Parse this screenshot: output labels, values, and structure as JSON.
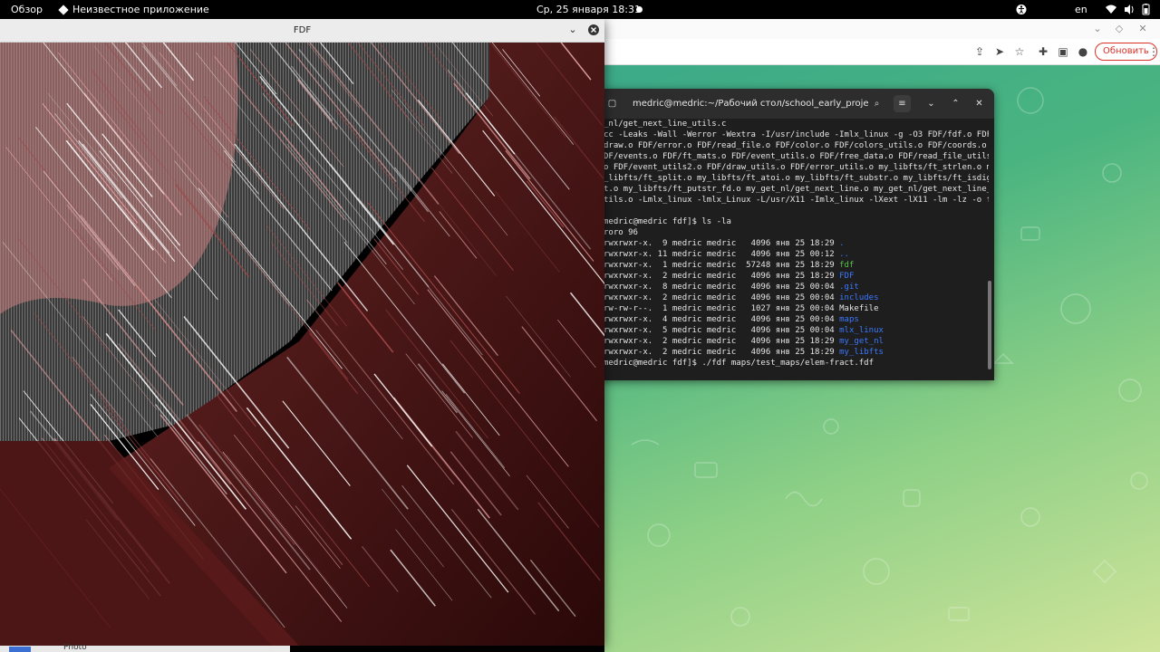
{
  "topbar": {
    "activities": "Обзор",
    "app_name": "Неизвестное приложение",
    "clock": "Ср, 25 января  18:31",
    "keyboard_layout": "en"
  },
  "browser": {
    "update_button": "Обновить"
  },
  "terminal": {
    "title": "medric@medric:~/Рабочий стол/school_early_projec...",
    "lines": [
      "_nl/get_next_line_utils.c",
      "cc -Leaks -Wall -Werror -Wextra -I/usr/include -Imlx_linux -g -O3 FDF/fdf.o FDF",
      "draw.o FDF/error.o FDF/read_file.o FDF/color.o FDF/colors_utils.o FDF/coords.o",
      "DF/events.o FDF/ft_mats.o FDF/event_utils.o FDF/free_data.o FDF/read_file_utils",
      "o FDF/event_utils2.o FDF/draw_utils.o FDF/error_utils.o my_libfts/ft_strlen.o m",
      "_libfts/ft_split.o my_libfts/ft_atoi.o my_libfts/ft_substr.o my_libfts/ft_isdig",
      "t.o my_libfts/ft_putstr_fd.o my_get_nl/get_next_line.o my_get_nl/get_next_line_",
      "tils.o -Lmlx_linux -lmlx_Linux -L/usr/X11 -Imlx_linux -lXext -lX11 -lm -lz -o f",
      "",
      "medric@medric fdf]$ ls -la",
      "roro 96"
    ],
    "ls_rows": [
      {
        "perm": "rwxrwxr-x.",
        "links": " 9",
        "owner": "medric",
        "group": "medric",
        "size": " 4096",
        "date": "янв 25 18:29",
        "name": ".",
        "kind": "dir"
      },
      {
        "perm": "rwxrwxr-x.",
        "links": "11",
        "owner": "medric",
        "group": "medric",
        "size": " 4096",
        "date": "янв 25 00:12",
        "name": "..",
        "kind": "dir"
      },
      {
        "perm": "rwxrwxr-x.",
        "links": " 1",
        "owner": "medric",
        "group": "medric",
        "size": "57248",
        "date": "янв 25 18:29",
        "name": "fdf",
        "kind": "exe"
      },
      {
        "perm": "rwxrwxr-x.",
        "links": " 2",
        "owner": "medric",
        "group": "medric",
        "size": " 4096",
        "date": "янв 25 18:29",
        "name": "FDF",
        "kind": "dir"
      },
      {
        "perm": "rwxrwxr-x.",
        "links": " 8",
        "owner": "medric",
        "group": "medric",
        "size": " 4096",
        "date": "янв 25 00:04",
        "name": ".git",
        "kind": "dir"
      },
      {
        "perm": "rwxrwxr-x.",
        "links": " 2",
        "owner": "medric",
        "group": "medric",
        "size": " 4096",
        "date": "янв 25 00:04",
        "name": "includes",
        "kind": "dir"
      },
      {
        "perm": "rw-rw-r--.",
        "links": " 1",
        "owner": "medric",
        "group": "medric",
        "size": " 1027",
        "date": "янв 25 00:04",
        "name": "Makefile",
        "kind": "file"
      },
      {
        "perm": "rwxrwxr-x.",
        "links": " 4",
        "owner": "medric",
        "group": "medric",
        "size": " 4096",
        "date": "янв 25 00:04",
        "name": "maps",
        "kind": "dir"
      },
      {
        "perm": "rwxrwxr-x.",
        "links": " 5",
        "owner": "medric",
        "group": "medric",
        "size": " 4096",
        "date": "янв 25 00:04",
        "name": "mlx_linux",
        "kind": "dir"
      },
      {
        "perm": "rwxrwxr-x.",
        "links": " 2",
        "owner": "medric",
        "group": "medric",
        "size": " 4096",
        "date": "янв 25 18:29",
        "name": "my_get_nl",
        "kind": "dir"
      },
      {
        "perm": "rwxrwxr-x.",
        "links": " 2",
        "owner": "medric",
        "group": "medric",
        "size": " 4096",
        "date": "янв 25 18:29",
        "name": "my_libfts",
        "kind": "dir"
      }
    ],
    "last_command": "medric@medric fdf]$ ./fdf maps/test_maps/elem-fract.fdf"
  },
  "fdf_window": {
    "title": "FDF"
  },
  "taskbar": {
    "label": "Photo"
  },
  "colors": {
    "terminal_bg": "#1e1e1e",
    "dir": "#3b78ff",
    "exe": "#5ec24b",
    "update_red": "#d93025"
  }
}
